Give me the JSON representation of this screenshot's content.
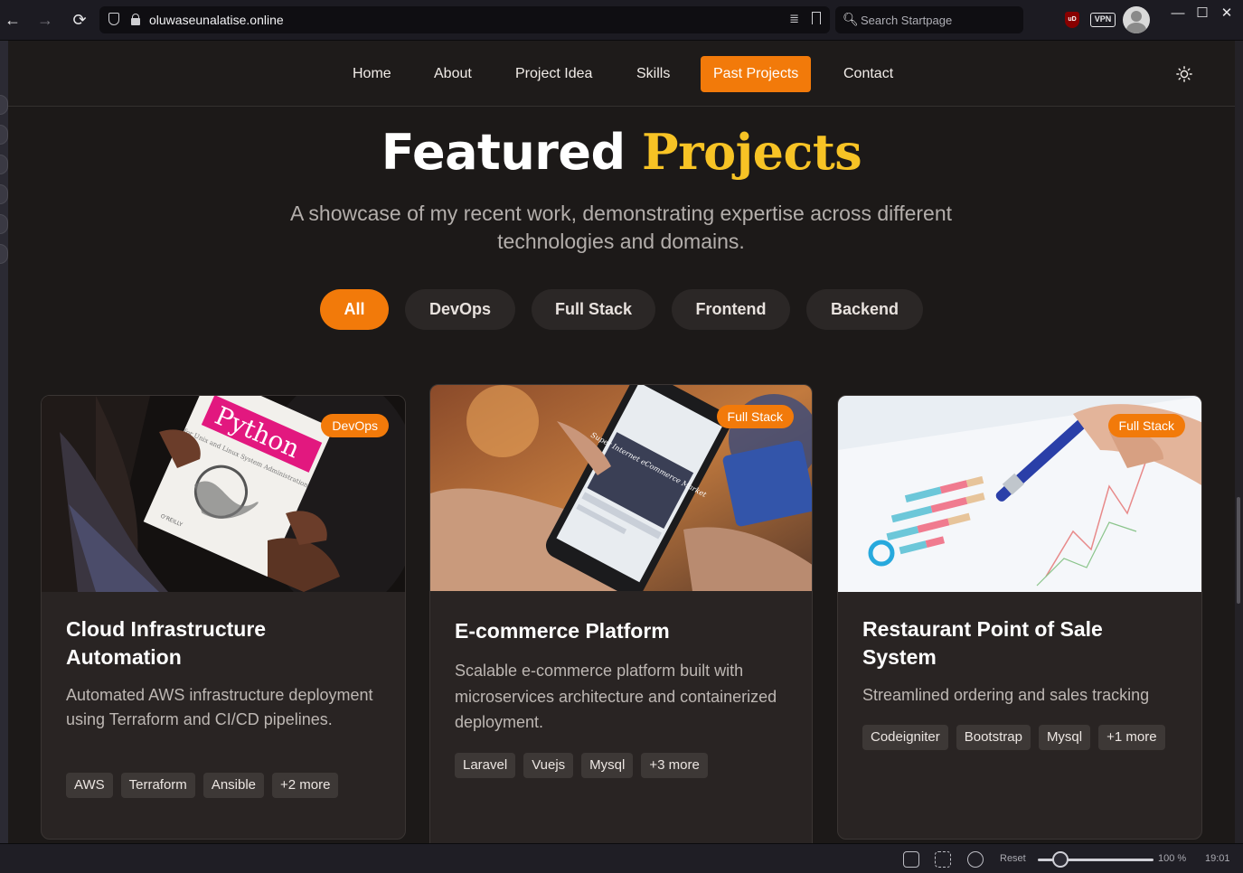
{
  "browser": {
    "url": "oluwaseunalatise.online",
    "search_placeholder": "Search Startpage",
    "vpn_label": "VPN",
    "ublock_label": "uD",
    "back_icon": "←",
    "forward_icon": "→",
    "reload_icon": "⟳",
    "reader_icon": "≣",
    "search_icon": "🔍︎",
    "minimize_icon": "—",
    "maximize_icon": "☐",
    "close_icon": "✕"
  },
  "site_nav": {
    "links": [
      "Home",
      "About",
      "Project Idea",
      "Skills",
      "Past Projects",
      "Contact"
    ],
    "active": "Past Projects",
    "accent_color": "#f27a0a"
  },
  "hero": {
    "title_main": "Featured",
    "title_accent": "Projects",
    "subtitle": "A showcase of my recent work, demonstrating expertise across different technologies and domains."
  },
  "filters": [
    "All",
    "DevOps",
    "Full Stack",
    "Frontend",
    "Backend"
  ],
  "active_filter": "All",
  "projects": [
    {
      "title": "Cloud Infrastructure Automation",
      "category": "DevOps",
      "description": "Automated AWS infrastructure deployment using Terraform and CI/CD pipelines.",
      "tags": [
        "AWS",
        "Terraform",
        "Ansible",
        "+2 more"
      ],
      "image_book_title": "Python",
      "image_book_subtitle": "for Unix and Linux System Administration",
      "image_publisher": "O'REILLY"
    },
    {
      "title": "E-commerce Platform",
      "category": "Full Stack",
      "description": "Scalable e-commerce platform built with microservices architecture and containerized deployment.",
      "tags": [
        "Laravel",
        "Vuejs",
        "Mysql",
        "+3 more"
      ],
      "image_screen_text": "Super Internet eCommerce Market"
    },
    {
      "title": "Restaurant Point of Sale System",
      "category": "Full Stack",
      "description": "Streamlined ordering and sales tracking",
      "tags": [
        "Codeigniter",
        "Bootstrap",
        "Mysql",
        "+1 more"
      ]
    }
  ],
  "statusbar": {
    "reset_label": "Reset",
    "zoom": "100 %",
    "time": "19:01"
  }
}
